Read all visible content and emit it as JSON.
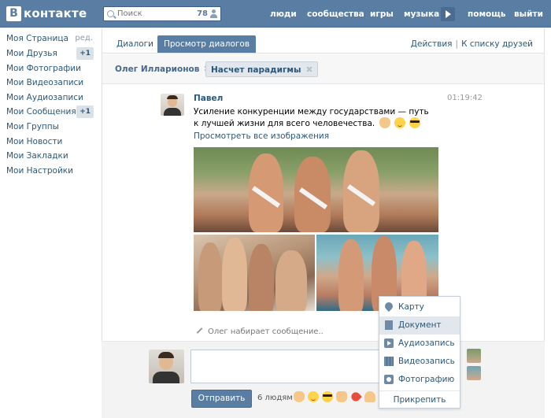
{
  "header": {
    "logo_text": "контакте",
    "logo_letter": "В",
    "search_placeholder": "Поиск",
    "search_count": "78",
    "nav": [
      "люди",
      "сообщества",
      "игры",
      "музыка",
      "помощь",
      "выйти"
    ]
  },
  "sidebar": {
    "edit_label": "ред.",
    "items": [
      {
        "label": "Моя Страница"
      },
      {
        "label": "Мои Друзья",
        "badge": "+1"
      },
      {
        "label": "Мои Фотографии"
      },
      {
        "label": "Мои Видеозаписи"
      },
      {
        "label": "Мои Аудиозаписи"
      },
      {
        "label": "Мои Сообщения",
        "badge": "+1"
      },
      {
        "label": "Мои Группы"
      },
      {
        "label": "Мои Новости"
      },
      {
        "label": "Мои Закладки"
      },
      {
        "label": "Мои Настройки"
      }
    ]
  },
  "tabs": {
    "dialogs": "Диалоги",
    "view_dialogs": "Просмотр диалогов",
    "actions": "Действия",
    "separator": "|",
    "to_friends": "К списку друзей"
  },
  "peers": [
    {
      "name": "Олег Илларионов"
    },
    {
      "name": "Насчет парадигмы"
    }
  ],
  "message": {
    "author": "Павел",
    "time": "01:19:42",
    "text": "Усиление конкуренции между государствами — путь к лучшей жизни для всего человечества.",
    "view_all": "Просмотреть все изображения"
  },
  "typing": "Олег набирает сообщение..",
  "composer": {
    "send": "Отправить",
    "people": "6 людям"
  },
  "attach_menu": {
    "items": [
      "Карту",
      "Документ",
      "Аудиозапись",
      "Видеозапись",
      "Фотографию"
    ],
    "footer": "Прикрепить"
  }
}
